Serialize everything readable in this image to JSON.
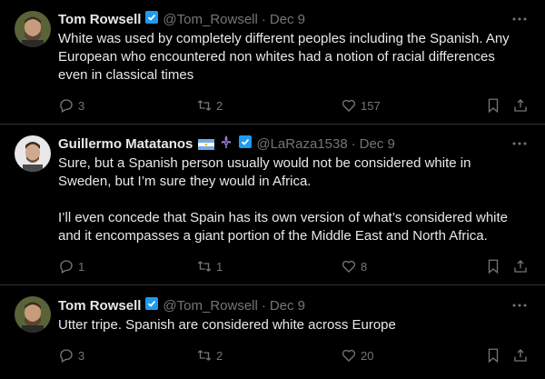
{
  "tweets": [
    {
      "name": "Tom Rowsell",
      "handle": "@Tom_Rowsell",
      "separator": "·",
      "date": "Dec 9",
      "text_lines": [
        "White was used by completely different peoples including the Spanish. Any",
        "European who encountered non whites had a notion of racial differences",
        "even in classical times"
      ],
      "replies": "3",
      "reposts": "2",
      "likes": "157"
    },
    {
      "name": "Guillermo Matatanos",
      "handle": "@LaRaza1538",
      "separator": "·",
      "date": "Dec 9",
      "text_lines": [
        "Sure, but a Spanish person usually would not be considered white in",
        "Sweden, but I’m sure they would in Africa.",
        "",
        "I’ll even concede that Spain has its own version of what’s considered white",
        "and it encompasses a giant portion of the Middle East and North Africa."
      ],
      "replies": "1",
      "reposts": "1",
      "likes": "8"
    },
    {
      "name": "Tom Rowsell",
      "handle": "@Tom_Rowsell",
      "separator": "·",
      "date": "Dec 9",
      "text_lines": [
        "Utter tripe. Spanish are considered white across Europe"
      ],
      "replies": "3",
      "reposts": "2",
      "likes": "20"
    }
  ],
  "colors": {
    "background": "#000000",
    "text": "#e7e9ea",
    "muted": "#71767b",
    "verified": "#1d9bf0",
    "divider": "#2f3336"
  }
}
